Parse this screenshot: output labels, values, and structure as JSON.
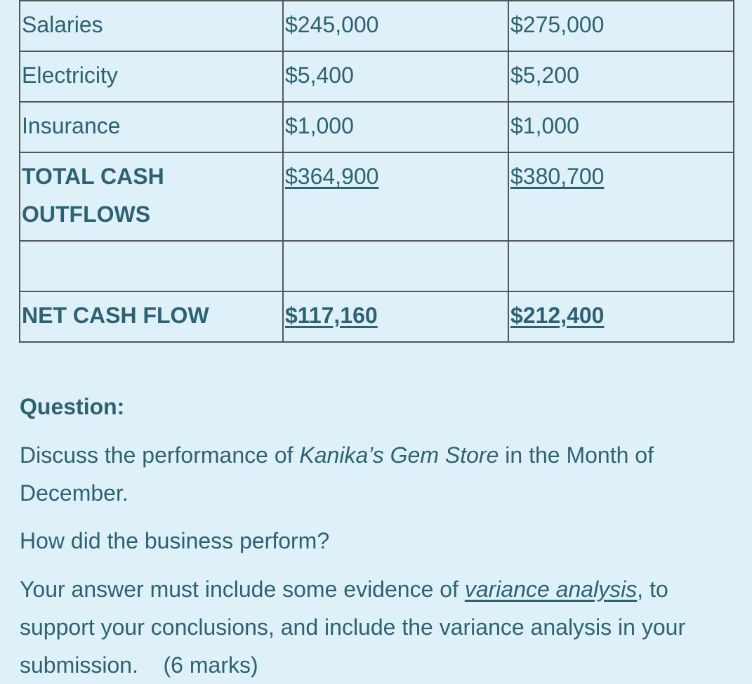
{
  "table": {
    "rows": [
      {
        "label": "Salaries",
        "col1": "$245,000",
        "col2": "$275,000"
      },
      {
        "label": "Electricity",
        "col1": "$5,400",
        "col2": "$5,200"
      },
      {
        "label": "Insurance",
        "col1": "$1,000",
        "col2": "$1,000"
      },
      {
        "label_line1": "TOTAL CASH",
        "label_line2": "OUTFLOWS",
        "col1": "$364,900",
        "col2": "$380,700"
      },
      {
        "label": "",
        "col1": "",
        "col2": ""
      },
      {
        "label": "NET CASH FLOW",
        "col1": "$117,160",
        "col2": "$212,400"
      }
    ]
  },
  "question": {
    "heading": "Question:",
    "p1": {
      "before": "Discuss the performance of ",
      "italic": "Kanika’s Gem Store",
      "after": " in the Month of December."
    },
    "p2": "How did the business perform?",
    "p3": {
      "before": "Your answer must include some evidence of ",
      "underline_italic": "variance analysis",
      "after": ", to support your conclusions, and include the variance analysis in your submission.",
      "marks": "(6 marks)"
    }
  },
  "colors": {
    "background": "#dff1f8",
    "text": "#2c6272",
    "border": "#555555"
  }
}
